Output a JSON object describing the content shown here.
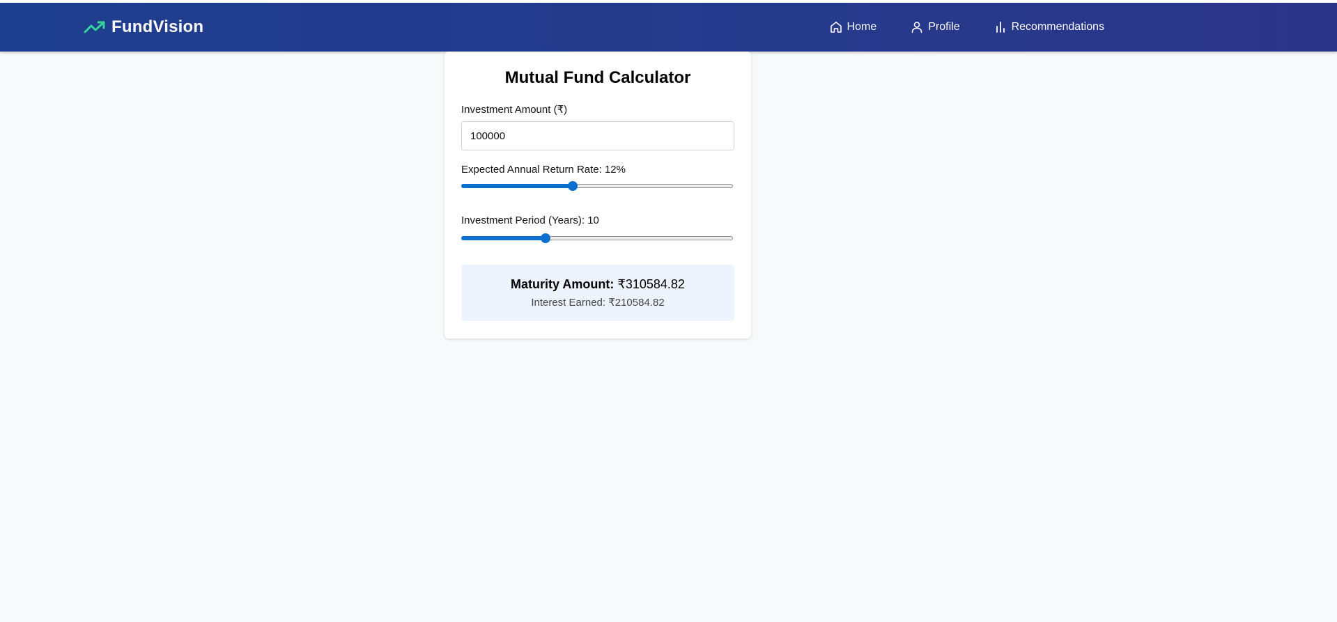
{
  "brand": {
    "name": "FundVision",
    "icon": "trending-up-icon",
    "icon_color": "#34d399"
  },
  "nav": {
    "items": [
      {
        "label": "Home",
        "icon": "home-icon"
      },
      {
        "label": "Profile",
        "icon": "user-icon"
      },
      {
        "label": "Recommendations",
        "icon": "bar-chart-icon"
      }
    ]
  },
  "calculator": {
    "title": "Mutual Fund Calculator",
    "amount_label": "Investment Amount (₹)",
    "amount_value": "100000",
    "rate_label": "Expected Annual Return Rate: 12%",
    "rate_fraction": 0.41,
    "period_label": "Investment Period (Years): 10",
    "period_fraction": 0.31,
    "maturity_label": "Maturity Amount:",
    "maturity_value": "₹310584.82",
    "interest_text": "Interest Earned: ₹210584.82"
  },
  "colors": {
    "navbar": "#263a8c",
    "accent": "#0b6fd0",
    "result_bg": "#eef4fd",
    "page_bg": "#f8f9fb"
  }
}
